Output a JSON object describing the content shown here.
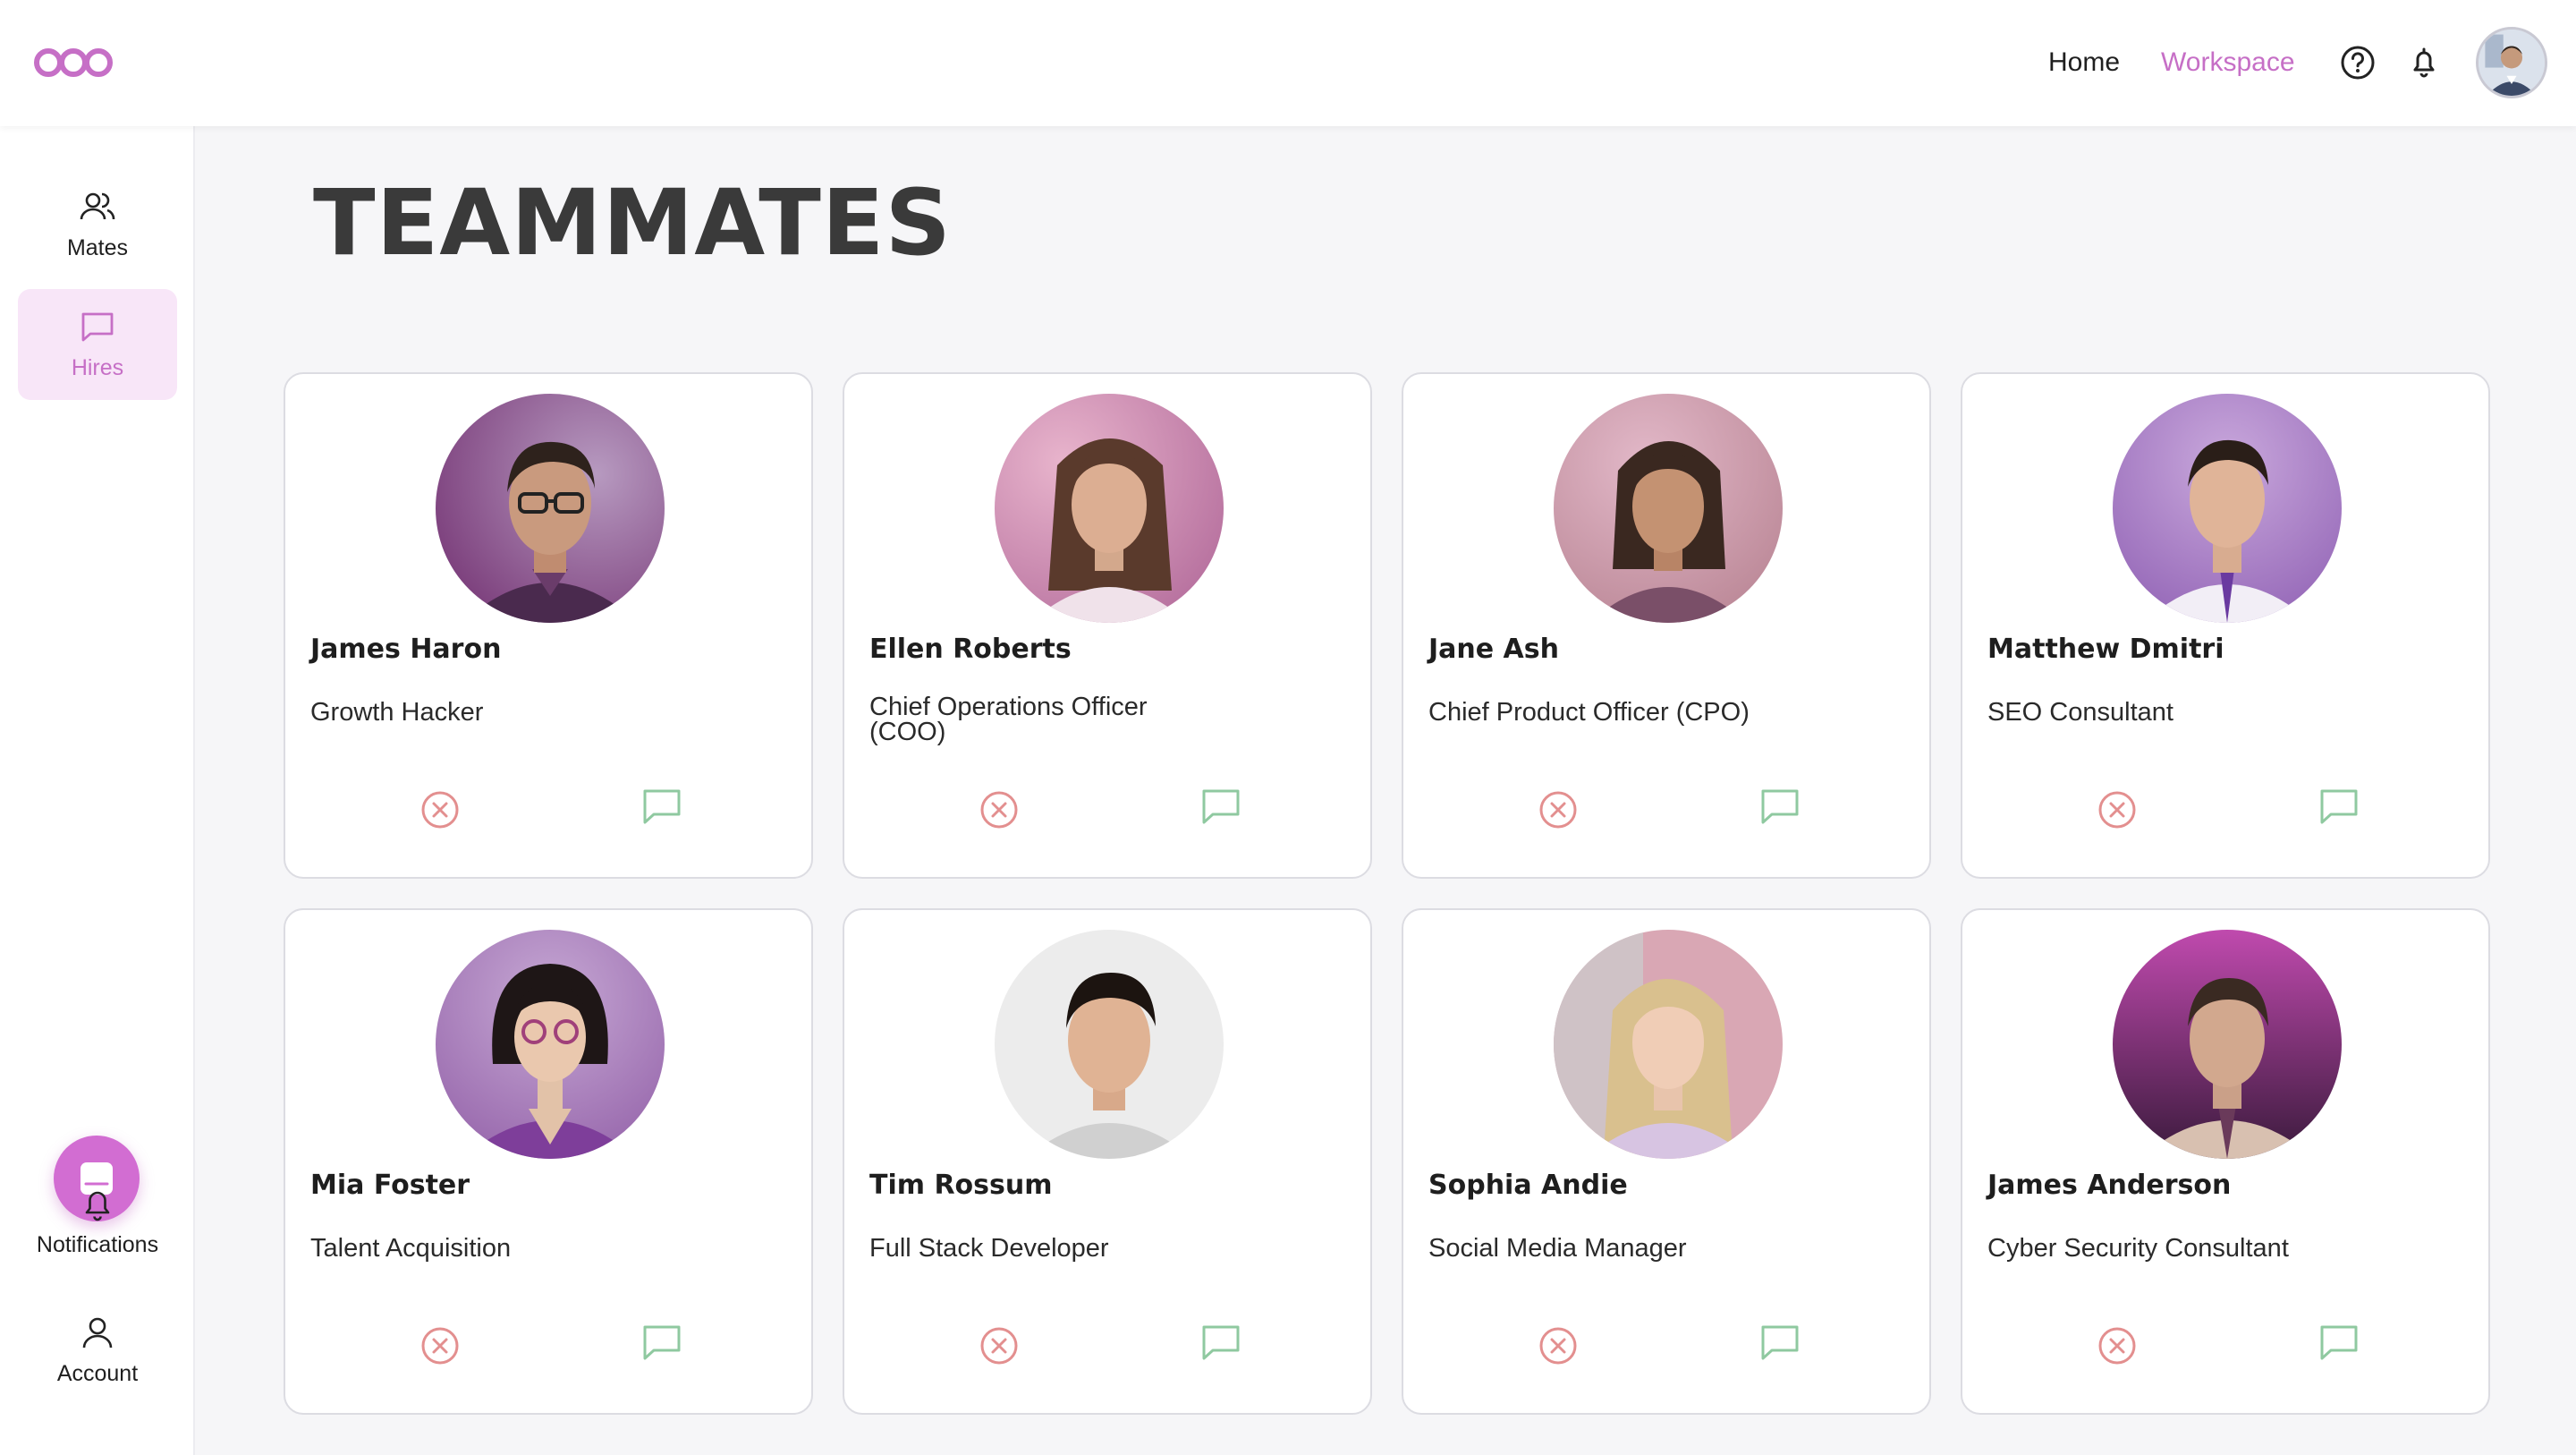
{
  "header": {
    "nav": {
      "home": "Home",
      "workspace": "Workspace"
    },
    "icons": [
      "infinity-logo",
      "help-icon",
      "bell-icon",
      "user-avatar"
    ],
    "accent_color": "#c66fc6"
  },
  "sidebar": {
    "items": [
      {
        "label": "Mates",
        "icon": "users-icon",
        "active": false
      },
      {
        "label": "Hires",
        "icon": "chat-icon",
        "active": true
      },
      {
        "label": "Notifications",
        "icon": "bell-icon",
        "active": false
      },
      {
        "label": "Account",
        "icon": "user-icon",
        "active": false
      }
    ],
    "fab_icon": "inbox-icon"
  },
  "main": {
    "title": "TEAMMATES",
    "cards": [
      {
        "name": "James Haron",
        "role": "Growth Hacker"
      },
      {
        "name": "Ellen Roberts",
        "role": "Chief Operations Officer (COO)"
      },
      {
        "name": "Jane Ash",
        "role": "Chief Product Officer (CPO)"
      },
      {
        "name": "Matthew Dmitri",
        "role": "SEO Consultant"
      },
      {
        "name": "Mia Foster",
        "role": "Talent Acquisition"
      },
      {
        "name": "Tim Rossum",
        "role": "Full Stack Developer"
      },
      {
        "name": "Sophia Andie",
        "role": "Social Media Manager"
      },
      {
        "name": "James Anderson",
        "role": "Cyber Security Consultant"
      }
    ],
    "card_actions": {
      "remove_icon": "remove-circle-icon",
      "remove_color": "#e38f8f",
      "chat_icon": "chat-bubble-icon",
      "chat_color": "#8fc9a0"
    }
  }
}
